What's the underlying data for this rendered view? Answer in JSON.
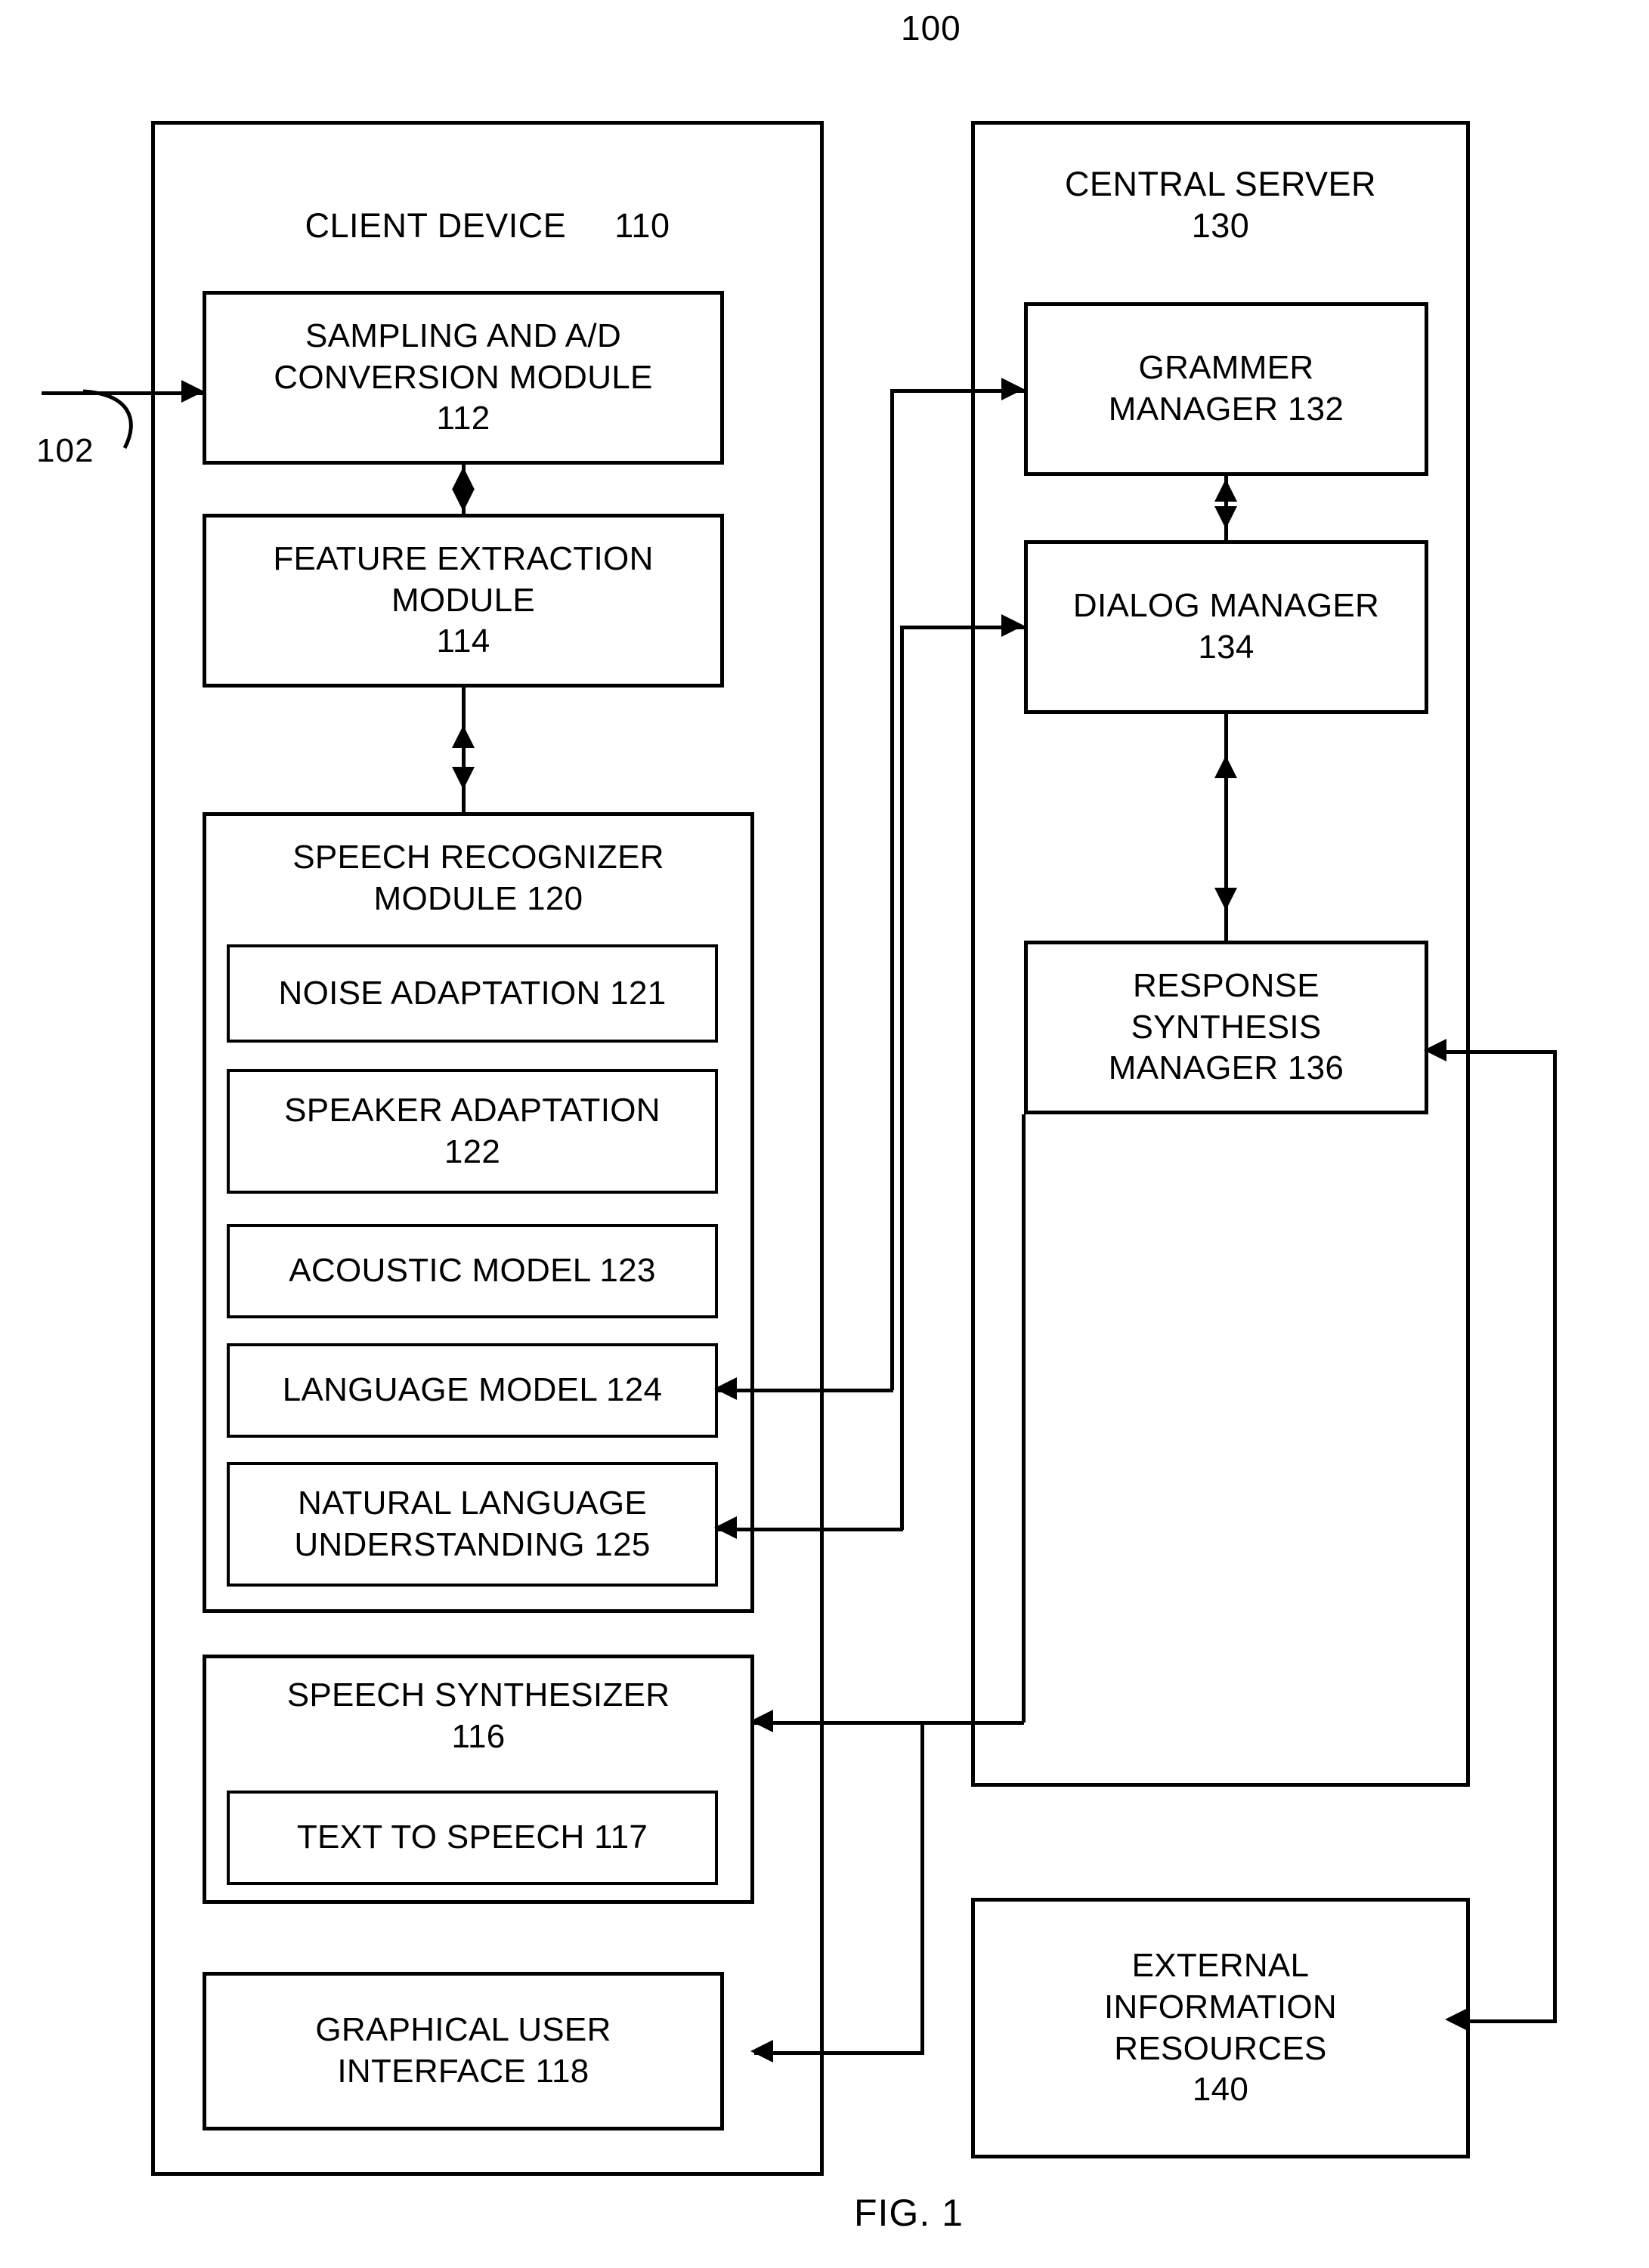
{
  "figure": {
    "system_number": "100",
    "caption": "FIG. 1",
    "input_label": "102"
  },
  "client_panel": {
    "title": "CLIENT DEVICE",
    "ref": "110",
    "modules": [
      {
        "label": "SAMPLING AND A/D\nCONVERSION MODULE\n112"
      },
      {
        "label": "FEATURE EXTRACTION\nMODULE\n114"
      }
    ],
    "speech_recognizer": {
      "title": "SPEECH RECOGNIZER\nMODULE       120",
      "submodules": [
        {
          "label": "NOISE ADAPTATION 121"
        },
        {
          "label": "SPEAKER ADAPTATION\n122"
        },
        {
          "label": "ACOUSTIC MODEL 123"
        },
        {
          "label": "LANGUAGE MODEL 124"
        },
        {
          "label": "NATURAL LANGUAGE\nUNDERSTANDING 125"
        }
      ]
    },
    "speech_synthesizer": {
      "title": "SPEECH SYNTHESIZER\n116",
      "submodules": [
        {
          "label": "TEXT TO SPEECH 117"
        }
      ]
    },
    "gui": {
      "label": "GRAPHICAL USER\nINTERFACE 118"
    }
  },
  "server_panel": {
    "title": "CENTRAL SERVER\n130",
    "modules": [
      {
        "label": "GRAMMER\nMANAGER 132"
      },
      {
        "label": "DIALOG MANAGER\n134"
      },
      {
        "label": "RESPONSE\nSYNTHESIS\nMANAGER 136"
      }
    ]
  },
  "external": {
    "label": "EXTERNAL\nINFORMATION\nRESOURCES\n140"
  },
  "colors": {
    "ink": "#000000",
    "paper": "#ffffff"
  }
}
